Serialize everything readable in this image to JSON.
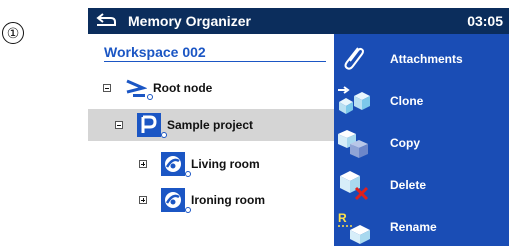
{
  "step_marker": "①",
  "header": {
    "title": "Memory Organizer",
    "time": "03:05"
  },
  "workspace": {
    "label": "Workspace 002"
  },
  "tree": {
    "root": {
      "label": "Root node"
    },
    "project": {
      "label": "Sample project"
    },
    "children": [
      {
        "label": "Living room"
      },
      {
        "label": "Ironing room"
      }
    ]
  },
  "menu": {
    "items": [
      {
        "label": "Attachments",
        "icon": "paperclip-icon"
      },
      {
        "label": "Clone",
        "icon": "clone-icon"
      },
      {
        "label": "Copy",
        "icon": "copy-icon"
      },
      {
        "label": "Delete",
        "icon": "delete-icon"
      },
      {
        "label": "Rename",
        "icon": "rename-icon"
      }
    ]
  },
  "colors": {
    "titlebar": "#0b2d5c",
    "menu": "#1a4db5",
    "accent": "#1b56c4",
    "selection": "#d5d5d5",
    "delete_x": "#e0201c"
  }
}
